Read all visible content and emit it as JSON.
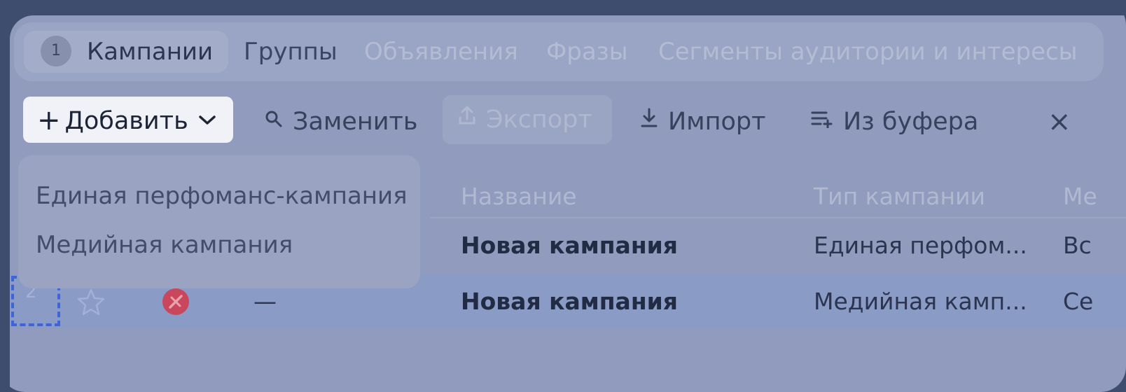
{
  "tabs": [
    {
      "badge": "1",
      "label": "Кампании"
    },
    {
      "label": "Группы"
    },
    {
      "label": "Объявления"
    },
    {
      "label": "Фразы"
    },
    {
      "label": "Сегменты аудитории и интересы"
    }
  ],
  "toolbar": {
    "add_label": "Добавить",
    "replace_label": "Заменить",
    "export_label": "Экспорт",
    "import_label": "Импорт",
    "buffer_label": "Из буфера",
    "close_glyph": "×"
  },
  "dropdown": {
    "items": [
      "Единая перфоманс-кампания",
      "Медийная кампания"
    ]
  },
  "table": {
    "headers": {
      "name": "Название",
      "type": "Тип кампании",
      "next": "Ме"
    },
    "rows": [
      {
        "name": "Новая кампания",
        "type": "Единая перфом...",
        "next": "Вс"
      },
      {
        "num": "2",
        "dash": "—",
        "name": "Новая кампания",
        "type": "Медийная камп...",
        "next": "Се"
      }
    ]
  },
  "colors": {
    "overlay": "#909bbd",
    "selection_dashed": "#3f63d9",
    "status_error": "#c9475c",
    "row_highlight": "#8a9bc6"
  }
}
